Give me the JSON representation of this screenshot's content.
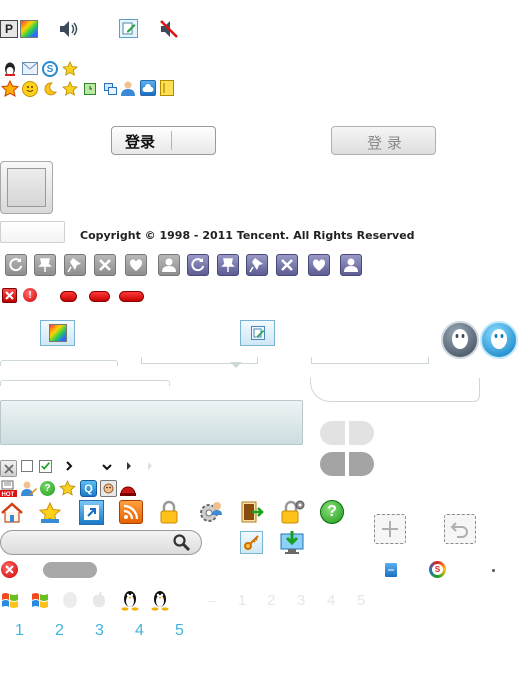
{
  "login_button": {
    "label": "登录"
  },
  "login_button_disabled": {
    "label": "登 录"
  },
  "copyright": "Copyright © 1998 - 2011 Tencent. All Rights Reserved",
  "number_tabs": [
    "1",
    "2",
    "3",
    "4",
    "5"
  ],
  "ghost_digits": [
    "1",
    "2",
    "3",
    "4",
    "5"
  ],
  "icons": {
    "row1": [
      "p-icon",
      "colors-icon",
      "speaker-icon",
      "edit-icon",
      "mute-icon"
    ],
    "row2": [
      "qq-penguin-icon",
      "mail-icon",
      "qq-wallet-icon",
      "star-icon"
    ],
    "row3": [
      "crown-star-icon",
      "smiley-icon",
      "moon-icon",
      "star-icon",
      "clock-icon",
      "window-icon",
      "user-icon",
      "cloud-icon",
      "book-icon"
    ],
    "gray_row": [
      "refresh-icon",
      "pin-icon",
      "unpin-icon",
      "close-icon",
      "heart-icon",
      "user-icon"
    ],
    "purple_row": [
      "refresh-icon",
      "pin-icon",
      "unpin-icon",
      "close-icon",
      "heart-icon",
      "user-icon"
    ]
  },
  "colors": {
    "accent_blue": "#3eb4e0",
    "gray_button": "#a8a8a8",
    "purple_button": "#7a7aa6",
    "red_pill": "#e00000"
  }
}
